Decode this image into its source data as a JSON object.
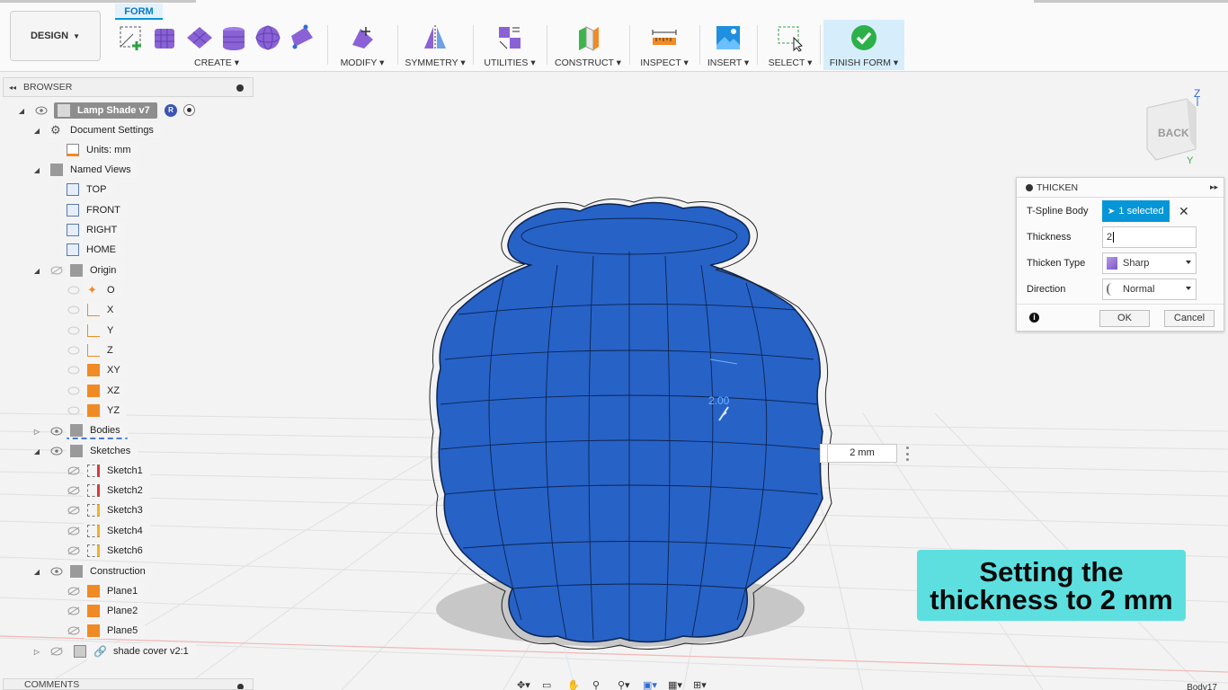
{
  "toolbar": {
    "design_label": "DESIGN",
    "form_tab": "FORM",
    "groups": {
      "create": "CREATE",
      "modify": "MODIFY",
      "symmetry": "SYMMETRY",
      "utilities": "UTILITIES",
      "construct": "CONSTRUCT",
      "inspect": "INSPECT",
      "insert": "INSERT",
      "select": "SELECT",
      "finish_form": "FINISH FORM"
    }
  },
  "browser": {
    "title": "BROWSER",
    "root": "Lamp Shade v7",
    "document_settings": "Document Settings",
    "units": "Units: mm",
    "named_views": "Named Views",
    "views": [
      "TOP",
      "FRONT",
      "RIGHT",
      "HOME"
    ],
    "origin": "Origin",
    "origin_items": [
      "O",
      "X",
      "Y",
      "Z",
      "XY",
      "XZ",
      "YZ"
    ],
    "bodies": "Bodies",
    "sketches": "Sketches",
    "sketch_items": [
      "Sketch1",
      "Sketch2",
      "Sketch3",
      "Sketch4",
      "Sketch6"
    ],
    "construction": "Construction",
    "planes": [
      "Plane1",
      "Plane2",
      "Plane5"
    ],
    "link": "shade cover v2:1"
  },
  "thicken": {
    "title": "THICKEN",
    "tspline_label": "T-Spline Body",
    "selected": "1 selected",
    "thickness_label": "Thickness",
    "thickness_value": "2",
    "thicken_type_label": "Thicken Type",
    "thicken_type_value": "Sharp",
    "direction_label": "Direction",
    "direction_value": "Normal",
    "ok": "OK",
    "cancel": "Cancel"
  },
  "viewport": {
    "dimension_input": "2 mm",
    "manipulator_label": "2.00",
    "viewcube_face": "BACK",
    "axis_z": "Z",
    "axis_y": "Y"
  },
  "caption": {
    "line1": "Setting the",
    "line2": "thickness to 2 mm"
  },
  "bottom": {
    "comments": "COMMENTS",
    "status": "Body17"
  }
}
